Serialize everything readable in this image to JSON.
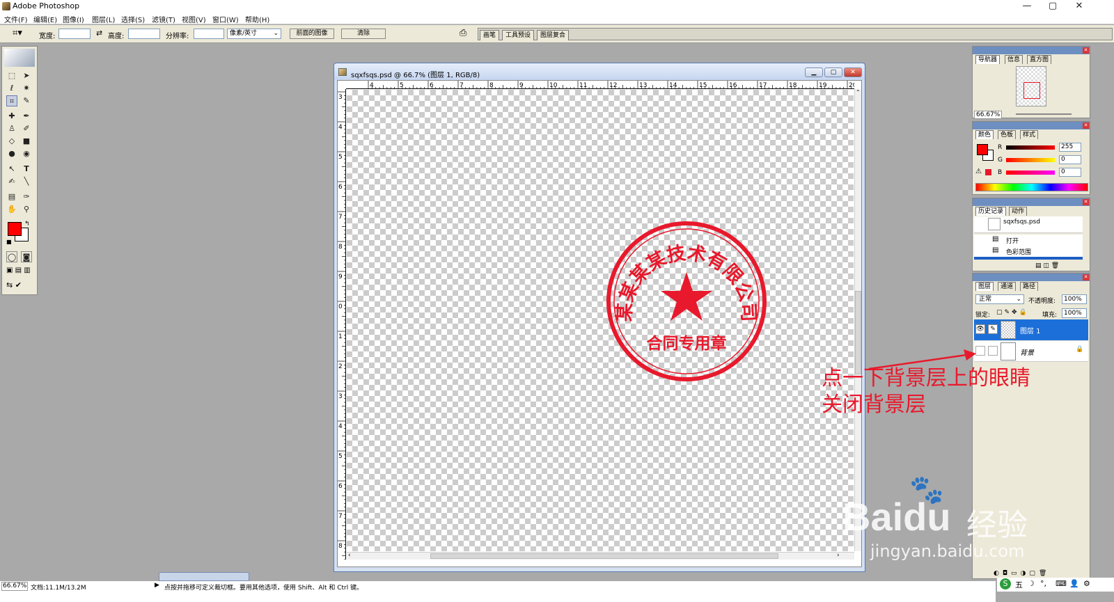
{
  "app": {
    "title": "Adobe Photoshop",
    "min": "—",
    "max": "▢",
    "close": "✕"
  },
  "menu": [
    "文件(F)",
    "编辑(E)",
    "图像(I)",
    "图层(L)",
    "选择(S)",
    "滤镜(T)",
    "视图(V)",
    "窗口(W)",
    "帮助(H)"
  ],
  "options": {
    "width_label": "宽度:",
    "height_label": "高度:",
    "resolution_label": "分辨率:",
    "unit_select": "像素/英寸",
    "front_image_button": "前面的图像",
    "clear_button": "清除",
    "well_tabs": [
      "画笔",
      "工具预设",
      "图层复合"
    ]
  },
  "document": {
    "title": "sqxfsqs.psd @ 66.7% (图层 1, RGB/8)",
    "h_ruler": [
      "4",
      "5",
      "6",
      "7",
      "8",
      "9",
      "10",
      "11",
      "12",
      "13",
      "14",
      "15",
      "16",
      "17",
      "18",
      "19",
      "20"
    ],
    "v_ruler": [
      "3",
      "4",
      "5",
      "6",
      "7",
      "8",
      "9",
      "0",
      "1",
      "2",
      "3",
      "4",
      "5",
      "6",
      "7",
      "8"
    ]
  },
  "stamp": {
    "top_text": "某某某某技术有限公司",
    "bottom_text": "合同专用章",
    "color": "#e8192c"
  },
  "navigator": {
    "tabs": [
      "导航器",
      "信息",
      "直方图"
    ],
    "zoom": "66.67%"
  },
  "color_panel": {
    "tabs": [
      "颜色",
      "色板",
      "样式"
    ],
    "r_label": "R",
    "g_label": "G",
    "b_label": "B",
    "r": "255",
    "g": "0",
    "b": "0",
    "fg_color": "#ff0000"
  },
  "history_panel": {
    "tabs": [
      "历史记录",
      "动作"
    ],
    "snapshot": "sqxfsqs.psd",
    "items": [
      "打开",
      "色彩范围"
    ]
  },
  "layers_panel": {
    "tabs": [
      "图层",
      "通道",
      "路径"
    ],
    "blend_mode": "正常",
    "opacity_label": "不透明度:",
    "opacity": "100%",
    "lock_label": "锁定:",
    "fill_label": "填充:",
    "fill": "100%",
    "layers": [
      {
        "name": "图层 1",
        "selected": true
      },
      {
        "name": "背景",
        "selected": false,
        "italic": true
      }
    ]
  },
  "status": {
    "zoom": "66.67%",
    "doc_size": "文档:11.1M/13.2M",
    "hint": "点按并拖移可定义裁切框。要用其他选项，使用 Shift、Alt 和 Ctrl 键。"
  },
  "annotation": {
    "line1": "点一下背景层上的眼睛",
    "line2": "关闭背景层",
    "color": "#e8192c"
  },
  "watermark": {
    "brand": "Baidu",
    "cn": "经验",
    "url": "jingyan.baidu.com"
  },
  "tray": [
    "五",
    "☽",
    "°,",
    "⌨",
    "👤",
    "⚙"
  ]
}
